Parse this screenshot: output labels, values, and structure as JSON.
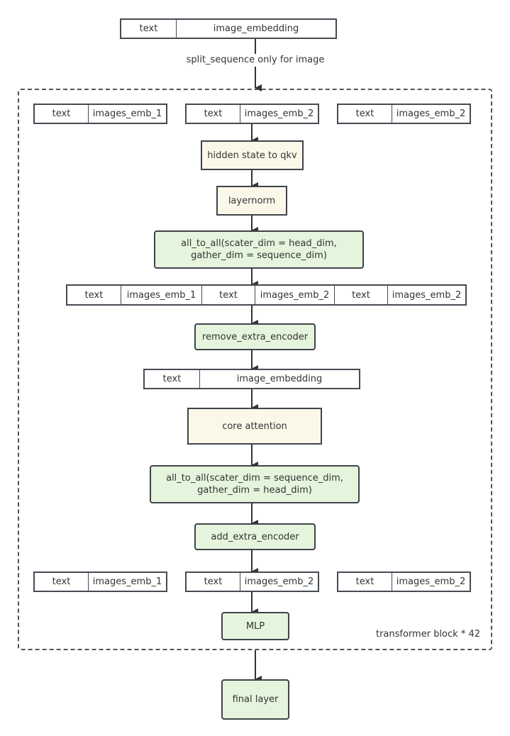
{
  "input_sequence": {
    "cells": [
      "text",
      "image_embedding"
    ]
  },
  "split_label": "split_sequence only for image",
  "block": {
    "label": "transformer block * 42",
    "row1": [
      {
        "text": "text",
        "image": "images_emb_1"
      },
      {
        "text": "text",
        "image": "images_emb_2"
      },
      {
        "text": "text",
        "image": "images_emb_2"
      }
    ],
    "hidden_state": "hidden state to qkv",
    "layernorm": "layernorm",
    "all_to_all_1": {
      "line1": "all_to_all(scater_dim = head_dim,",
      "line2": "gather_dim = sequence_dim)"
    },
    "gathered_row": [
      "text",
      "images_emb_1",
      "text",
      "images_emb_2",
      "text",
      "images_emb_2"
    ],
    "remove_extra": "remove_extra_encoder",
    "merged_sequence": [
      "text",
      "image_embedding"
    ],
    "core_attention": "core attention",
    "all_to_all_2": {
      "line1": "all_to_all(scater_dim = sequence_dim,",
      "line2": "gather_dim = head_dim)"
    },
    "add_extra": "add_extra_encoder",
    "row3": [
      {
        "text": "text",
        "image": "images_emb_1"
      },
      {
        "text": "text",
        "image": "images_emb_2"
      },
      {
        "text": "text",
        "image": "images_emb_2"
      }
    ],
    "mlp": "MLP"
  },
  "final_layer": "final layer",
  "colors": {
    "stroke": "#3f4449",
    "yellow_fill": "#fbf8ea",
    "green_fill": "#e5f4dc"
  }
}
